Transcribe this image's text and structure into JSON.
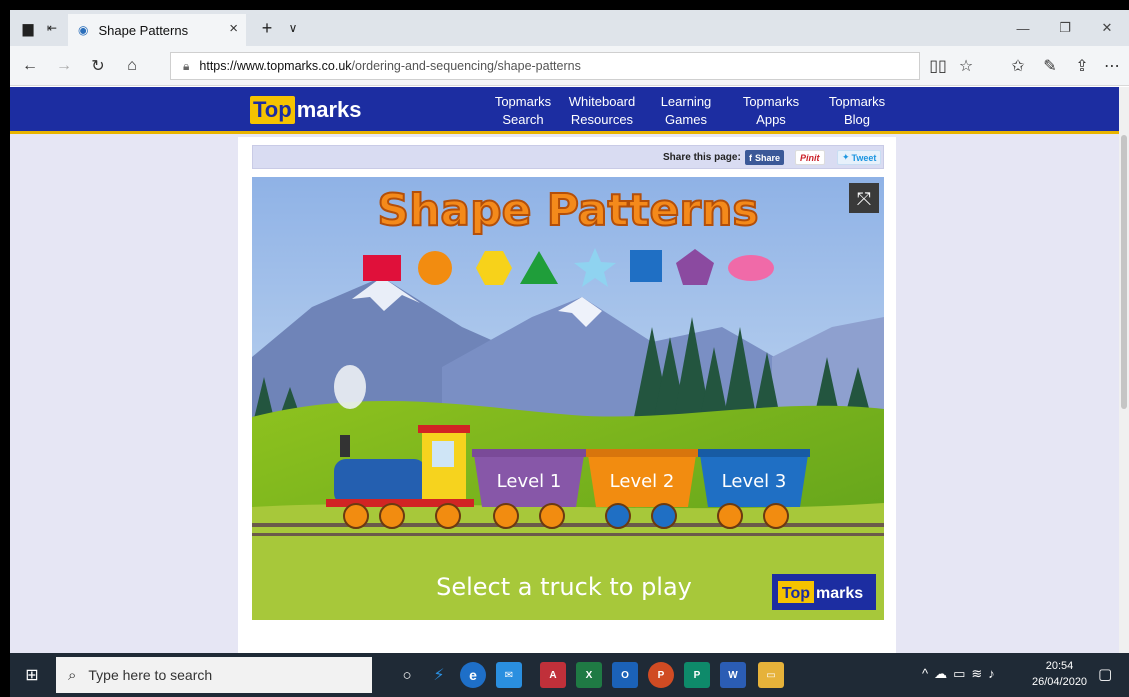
{
  "browser": {
    "tab_title": "Shape Patterns",
    "tab_close": "×",
    "new_tab": "+",
    "tab_menu": "∨",
    "url_host": "https://www.topmarks.co.uk",
    "url_path": "/ordering-and-sequencing/shape-patterns"
  },
  "site": {
    "logo_top": "Top",
    "logo_marks": "marks",
    "nav": [
      {
        "line1": "Topmarks",
        "line2": "Search"
      },
      {
        "line1": "Whiteboard",
        "line2": "Resources"
      },
      {
        "line1": "Learning",
        "line2": "Games"
      },
      {
        "line1": "Topmarks",
        "line2": "Apps"
      },
      {
        "line1": "Topmarks",
        "line2": "Blog"
      }
    ],
    "share_label": "Share this page:",
    "share_facebook": "Share",
    "share_pinterest": "Pinit",
    "share_twitter": "Tweet"
  },
  "game": {
    "title": "Shape Patterns",
    "levels": [
      "Level 1",
      "Level 2",
      "Level 3"
    ],
    "prompt": "Select a truck to play",
    "logo_top": "Top",
    "logo_marks": "marks",
    "shape_colors": {
      "rectangle": "#e0103a",
      "circle": "#f28c10",
      "hexagon": "#f7d21a",
      "triangle": "#1f9e3a",
      "star": "#8fd3f0",
      "square": "#1f6fc4",
      "pentagon": "#8b4aa0",
      "ellipse": "#f06aa8"
    }
  },
  "taskbar": {
    "search_placeholder": "Type here to search",
    "time": "20:54",
    "date": "26/04/2020"
  }
}
